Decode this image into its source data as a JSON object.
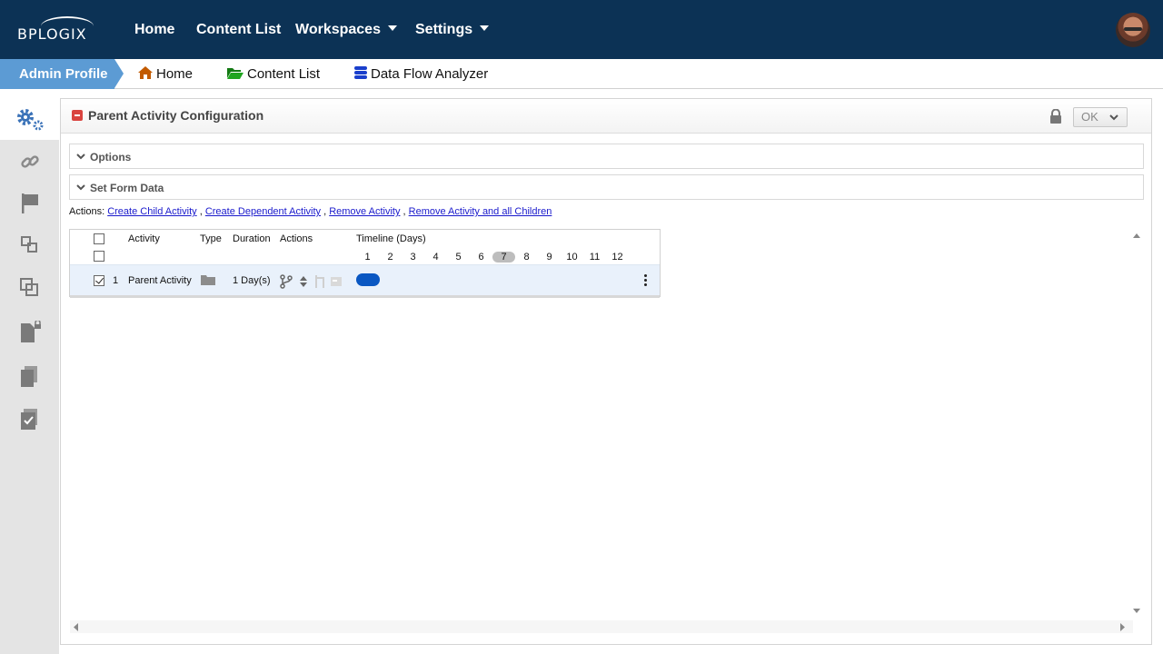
{
  "brand": {
    "logo_text": "BPLOGIX"
  },
  "topnav": {
    "items": [
      {
        "label": "Home"
      },
      {
        "label": "Content List"
      },
      {
        "label": "Workspaces"
      },
      {
        "label": "Settings"
      }
    ]
  },
  "breadcrumbs": {
    "profile": "Admin Profile",
    "items": [
      {
        "label": "Home",
        "icon": "home-icon",
        "color": "#c25a00"
      },
      {
        "label": "Content List",
        "icon": "folder-open-icon",
        "color": "#1a8a1a"
      },
      {
        "label": "Data Flow Analyzer",
        "icon": "database-icon",
        "color": "#1a3fcc"
      }
    ]
  },
  "sidebar": {
    "items": [
      {
        "icon": "gears-icon",
        "active": true
      },
      {
        "icon": "link-icon"
      },
      {
        "icon": "flag-icon"
      },
      {
        "icon": "subprocess-icon"
      },
      {
        "icon": "copy-icon"
      },
      {
        "icon": "locked-document-icon"
      },
      {
        "icon": "documents-icon"
      },
      {
        "icon": "checklist-icon"
      }
    ]
  },
  "panel": {
    "title": "Parent Activity Configuration",
    "ok_label": "OK",
    "sections": [
      {
        "label": "Options"
      },
      {
        "label": "Set Form Data"
      }
    ],
    "actions_prefix": "Actions:",
    "actions": [
      {
        "label": "Create Child Activity"
      },
      {
        "label": "Create Dependent Activity"
      },
      {
        "label": "Remove Activity"
      },
      {
        "label": "Remove Activity and all Children"
      }
    ],
    "actions_sep": ","
  },
  "grid": {
    "headers": {
      "activity": "Activity",
      "type": "Type",
      "duration": "Duration",
      "actions": "Actions",
      "timeline": "Timeline (Days)"
    },
    "timeline_days": [
      "1",
      "2",
      "3",
      "4",
      "5",
      "6",
      "7",
      "8",
      "9",
      "10",
      "11",
      "12"
    ],
    "current_day": "7",
    "rows": [
      {
        "checked": true,
        "index": "1",
        "activity": "Parent Activity",
        "type_icon": "folder-icon",
        "duration": "1 Day(s)",
        "bar_start_day": 1,
        "bar_days": 1
      }
    ]
  },
  "colors": {
    "topbar": "#0c3255",
    "profile_crumb": "#5c9bd4",
    "timeline_bar": "#0a57c2",
    "row_highlight": "#e9f1fb"
  }
}
